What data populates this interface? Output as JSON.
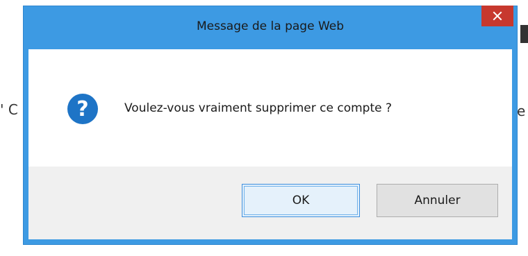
{
  "dialog": {
    "title": "Message de la page Web",
    "close_glyph": "✕",
    "icon": "question-icon",
    "icon_glyph": "?",
    "message": "Voulez-vous vraiment supprimer ce compte ?",
    "buttons": {
      "ok_label": "OK",
      "cancel_label": "Annuler"
    }
  },
  "background": {
    "left_fragment": "' C",
    "right_fragment": "e"
  },
  "colors": {
    "frame": "#3d9ae3",
    "close_button": "#c7382e",
    "question_icon": "#1e74c6",
    "button_bar": "#f0f0f0",
    "ok_focus_border": "#3c8ede"
  }
}
